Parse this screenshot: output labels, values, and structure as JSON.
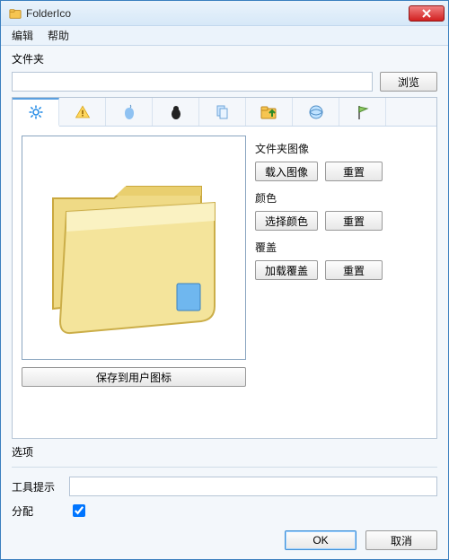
{
  "window": {
    "title": "FolderIco"
  },
  "menu": {
    "edit": "编辑",
    "help": "帮助"
  },
  "folder": {
    "label": "文件夹",
    "path": "",
    "browse": "浏览"
  },
  "tabs": {
    "icons": [
      "gear",
      "warning",
      "apple",
      "blob",
      "docs",
      "up",
      "ie",
      "flag"
    ]
  },
  "panel": {
    "image_label": "文件夹图像",
    "load_image": "载入图像",
    "reset_image": "重置",
    "color_label": "颜色",
    "choose_color": "选择颜色",
    "reset_color": "重置",
    "overlay_label": "覆盖",
    "load_overlay": "加载覆盖",
    "reset_overlay": "重置",
    "save_icon": "保存到用户图标"
  },
  "options": {
    "header": "选项",
    "tooltip_label": "工具提示",
    "tooltip_value": "",
    "assign_label": "分配",
    "assign_checked": true
  },
  "buttons": {
    "ok": "OK",
    "cancel": "取消"
  }
}
